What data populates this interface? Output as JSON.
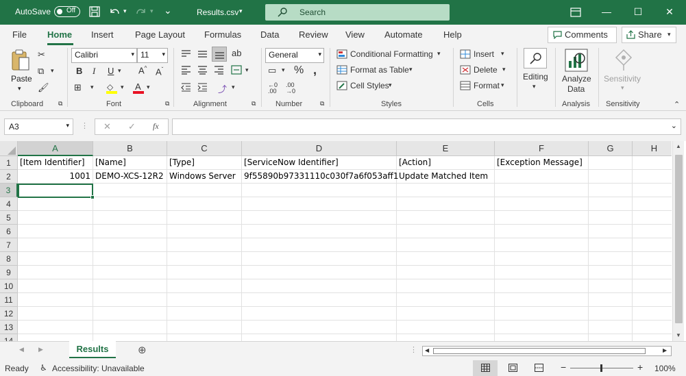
{
  "titlebar": {
    "autosave_label": "AutoSave",
    "autosave_state": "Off",
    "filename": "Results.csv",
    "search_placeholder": "Search"
  },
  "menu": {
    "tabs": [
      "File",
      "Home",
      "Insert",
      "Page Layout",
      "Formulas",
      "Data",
      "Review",
      "View",
      "Automate",
      "Help"
    ],
    "active_tab": "Home",
    "comments_label": "Comments",
    "share_label": "Share"
  },
  "ribbon": {
    "clipboard": {
      "paste": "Paste",
      "group": "Clipboard"
    },
    "font": {
      "name": "Calibri",
      "size": "11",
      "group": "Font"
    },
    "alignment": {
      "group": "Alignment"
    },
    "number": {
      "format": "General",
      "group": "Number"
    },
    "styles": {
      "conditional": "Conditional Formatting",
      "table": "Format as Table",
      "cell": "Cell Styles",
      "group": "Styles"
    },
    "cells": {
      "insert": "Insert",
      "delete": "Delete",
      "format": "Format",
      "group": "Cells"
    },
    "editing": {
      "label": "Editing"
    },
    "analysis": {
      "line1": "Analyze",
      "line2": "Data",
      "group": "Analysis"
    },
    "sensitivity": {
      "label": "Sensitivity",
      "group": "Sensitivity"
    }
  },
  "formula_bar": {
    "name_box": "A3",
    "formula": ""
  },
  "grid": {
    "columns": [
      "A",
      "B",
      "C",
      "D",
      "E",
      "F",
      "G",
      "H"
    ],
    "rows": [
      "1",
      "2",
      "3",
      "4",
      "5",
      "6",
      "7",
      "8",
      "9",
      "10",
      "11",
      "12",
      "13",
      "14"
    ],
    "cells": {
      "A1": "[Item Identifier]",
      "B1": "[Name]",
      "C1": "[Type]",
      "D1": "[ServiceNow Identifier]",
      "E1": "[Action]",
      "F1": "[Exception Message]",
      "A2": "1001",
      "B2": "DEMO-XCS-12R2",
      "C2": "Windows Server",
      "D2": "9f55890b97331110c030f7a6f053aff1",
      "E2": "Update Matched Item",
      "F2": ""
    },
    "active_cell": "A3"
  },
  "sheets": {
    "tabs": [
      "Results"
    ],
    "active": "Results"
  },
  "status": {
    "ready": "Ready",
    "accessibility": "Accessibility: Unavailable",
    "zoom": "100%"
  },
  "colors": {
    "accent": "#217346",
    "titlebar": "#217346"
  }
}
